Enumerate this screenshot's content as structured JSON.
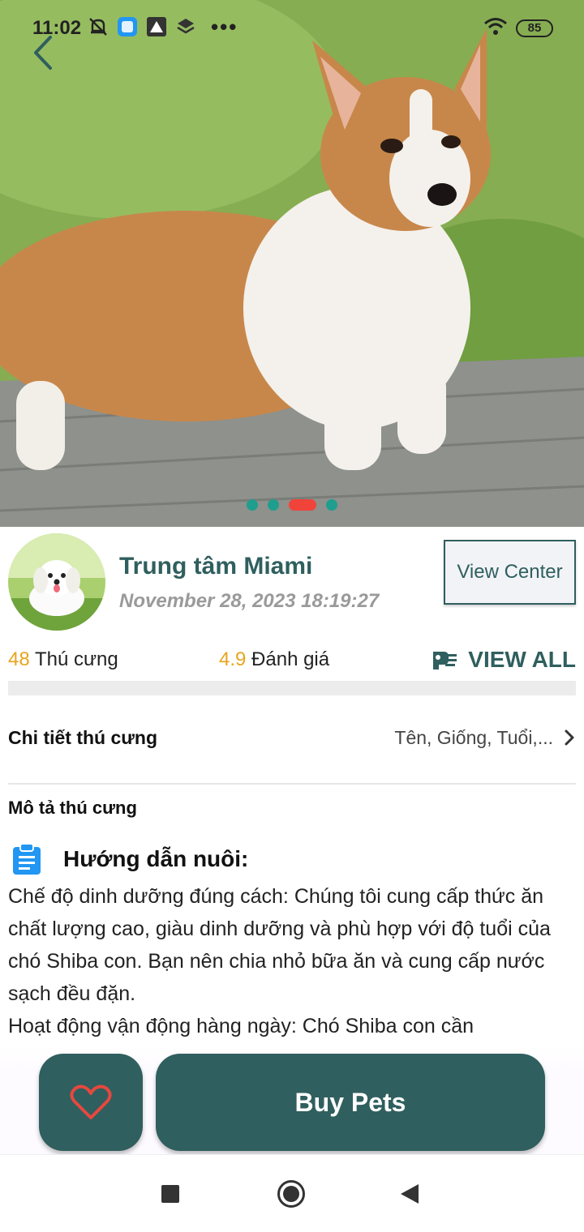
{
  "status_bar": {
    "time": "11:02",
    "more": "•••",
    "battery": "85"
  },
  "hero": {
    "image": "corgi-dog-photo",
    "pager": {
      "count": 4,
      "active_index": 2
    }
  },
  "center": {
    "name": "Trung tâm Miami",
    "date": "November 28, 2023 18:19:27",
    "view_center_label": "View Center",
    "avatar": "white-puppy-photo"
  },
  "stats": {
    "pets_count": "48",
    "pets_label": " Thú cưng",
    "rating": "4.9",
    "rating_label": " Đánh giá",
    "view_all_label": "VIEW ALL"
  },
  "details": {
    "title": "Chi tiết thú cưng",
    "summary": "Tên, Giống, Tuổi,..."
  },
  "description": {
    "title": "Mô tả thú cưng",
    "guide_title": "Hướng dẫn nuôi:",
    "paragraph_1": "Chế độ dinh dưỡng đúng cách: Chúng tôi cung cấp thức ăn chất lượng cao, giàu dinh dưỡng và phù hợp với độ tuổi của chó Shiba con. Bạn nên chia nhỏ bữa ăn và cung cấp nước sạch đều đặn.",
    "paragraph_2": "Hoạt động vận động hàng ngày: Chó Shiba con cần"
  },
  "actions": {
    "buy_label": "Buy Pets"
  },
  "colors": {
    "primary": "#2f5f5e",
    "accent_orange": "#e8a51e",
    "heart_red": "#e5483f",
    "pager_teal": "#1f9e8e",
    "pager_active": "#f0433a"
  }
}
